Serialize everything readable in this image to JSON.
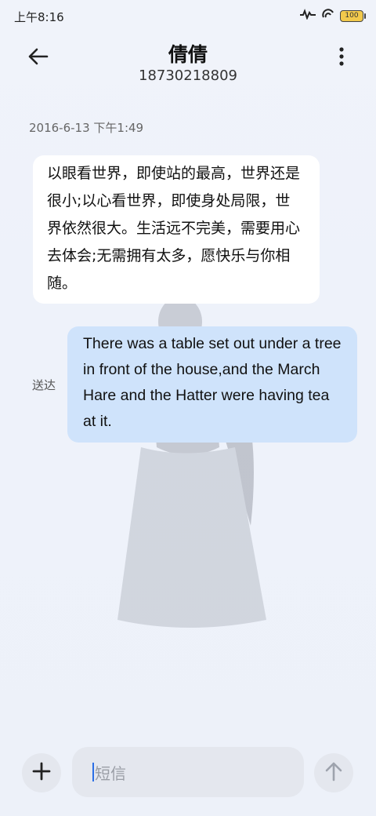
{
  "status_bar": {
    "time": "上午8:16",
    "battery": "100"
  },
  "header": {
    "contact_name": "倩倩",
    "phone_number": "18730218809"
  },
  "messages": {
    "timestamp": "2016-6-13 下午1:49",
    "received": {
      "text": "以眼看世界，即使站的最高，世界还是很小;以心看世界，即使身处局限，世界依然很大。生活远不完美，需要用心去体会;无需拥有太多，愿快乐与你相随。"
    },
    "sent": {
      "text": "There was a table set out under a tree in front of the house,and the March Hare and the Hatter were having tea at it.",
      "status": "送达"
    }
  },
  "composer": {
    "placeholder": "短信"
  },
  "icons": {
    "back": "back-arrow-icon",
    "more": "more-vertical-icon",
    "add": "plus-icon",
    "send": "send-arrow-up-icon"
  },
  "colors": {
    "sent_bubble": "#cfe3fb",
    "received_bubble": "#ffffff",
    "caret": "#2b6fe6"
  }
}
